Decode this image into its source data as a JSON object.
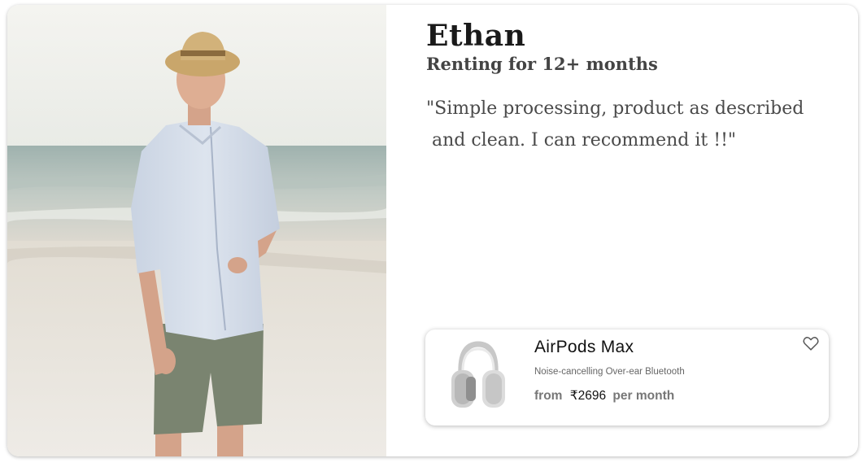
{
  "testimonial": {
    "name": "Ethan",
    "subtitle": "Renting for 12+ months",
    "quote": "\"Simple processing, product as described\n and clean. I can recommend it !!\""
  },
  "product": {
    "title": "AirPods Max",
    "description": "Noise-cancelling Over-ear Bluetooth",
    "price_prefix": "from",
    "price": "₹2696",
    "price_suffix": "per month",
    "favorite_icon": "heart-outline-icon"
  }
}
